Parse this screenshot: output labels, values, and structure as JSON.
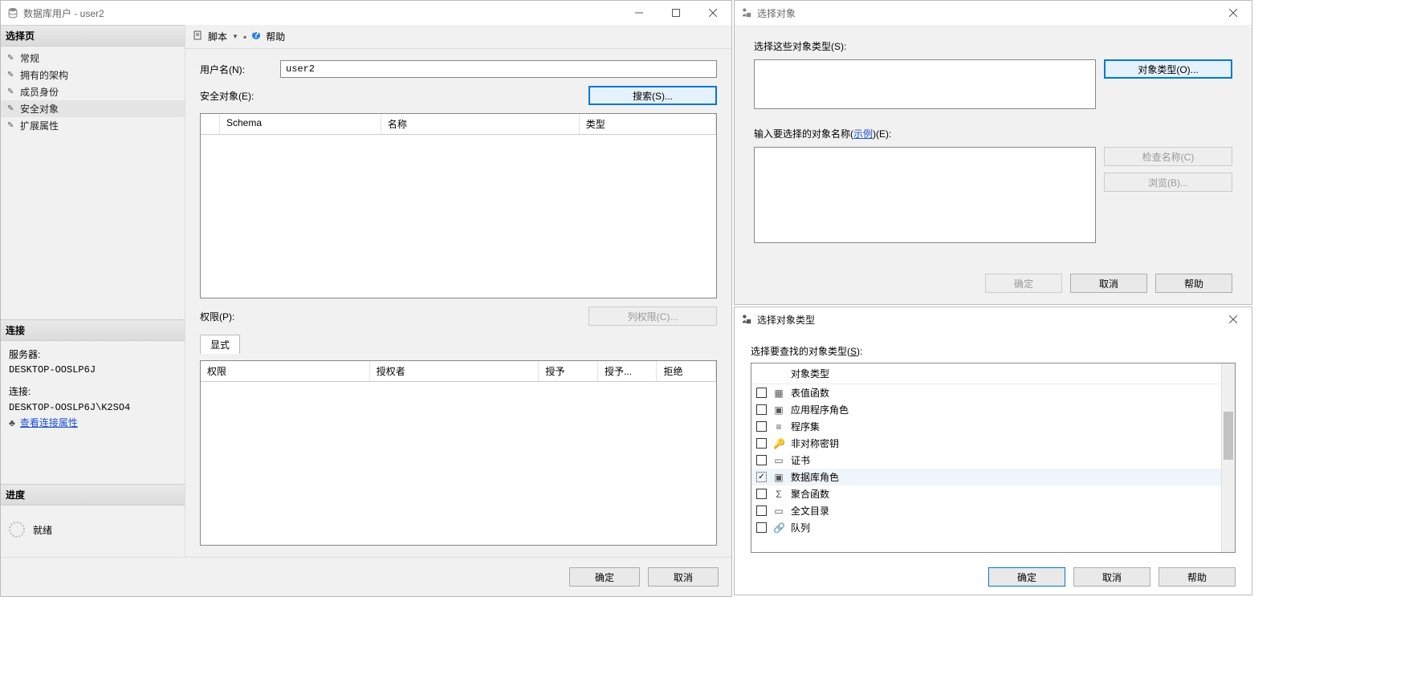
{
  "main": {
    "title": "数据库用户 - user2",
    "sidebar": {
      "pages_header": "选择页",
      "pages": [
        "常规",
        "拥有的架构",
        "成员身份",
        "安全对象",
        "扩展属性"
      ],
      "selected_page_index": 3,
      "connection_header": "连接",
      "server_label": "服务器:",
      "server_value": "DESKTOP-OOSLP6J",
      "conn_label": "连接:",
      "conn_value": "DESKTOP-OOSLP6J\\K2SO4",
      "view_props_link": "查看连接属性",
      "progress_header": "进度",
      "progress_status": "就绪"
    },
    "toolbar": {
      "script_label": "脚本",
      "help_label": "帮助"
    },
    "content": {
      "username_label": "用户名(N):",
      "username_value": "user2",
      "securables_label": "安全对象(E):",
      "search_btn": "搜索(S)...",
      "sec_cols": {
        "schema": "Schema",
        "name": "名称",
        "type": "类型"
      },
      "perm_label": "权限(P):",
      "colperm_btn": "列权限(C)...",
      "perm_tab": "显式",
      "perm_cols": {
        "perm": "权限",
        "grantor": "授权者",
        "grant": "授予",
        "withgrant": "授予...",
        "deny": "拒绝"
      }
    },
    "footer": {
      "ok": "确定",
      "cancel": "取消"
    }
  },
  "selectObjects": {
    "title": "选择对象",
    "types_label": "选择这些对象类型(S):",
    "object_types_btn": "对象类型(O)...",
    "names_label_pre": "输入要选择的对象名称(",
    "names_label_link": "示例",
    "names_label_post": ")(E):",
    "check_names_btn": "检查名称(C)",
    "browse_btn": "浏览(B)...",
    "ok": "确定",
    "cancel": "取消",
    "help": "帮助"
  },
  "selectTypes": {
    "title": "选择对象类型",
    "label_pre": "选择要查找的对象类型(",
    "label_accel": "S",
    "label_post": "):",
    "header": "对象类型",
    "items": [
      {
        "label": "表值函数",
        "checked": false
      },
      {
        "label": "应用程序角色",
        "checked": false
      },
      {
        "label": "程序集",
        "checked": false
      },
      {
        "label": "非对称密钥",
        "checked": false
      },
      {
        "label": "证书",
        "checked": false
      },
      {
        "label": "数据库角色",
        "checked": true,
        "selected": true
      },
      {
        "label": "聚合函数",
        "checked": false
      },
      {
        "label": "全文目录",
        "checked": false
      },
      {
        "label": "队列",
        "checked": false
      }
    ],
    "ok": "确定",
    "cancel": "取消",
    "help": "帮助"
  }
}
